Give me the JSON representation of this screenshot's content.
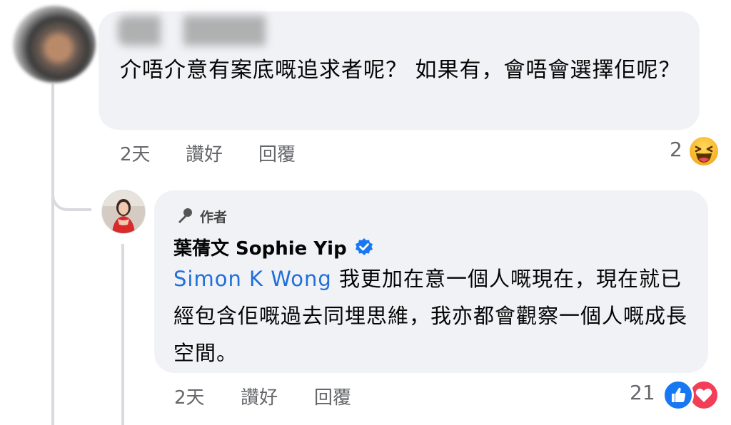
{
  "comment_1": {
    "text": "介唔介意有案底嘅追求者呢？ 如果有，會唔會選擇佢呢？",
    "time": "2天",
    "like_label": "讚好",
    "reply_label": "回覆",
    "reaction_count": "2",
    "reaction_icon": "haha-emoji-icon"
  },
  "comment_2": {
    "author_badge": "作者",
    "author_name": "葉蒨文 Sophie Yip",
    "mention": "Simon K Wong",
    "text": "我更加在意一個人嘅現在，現在就已經包含佢嘅過去同埋思維，我亦都會觀察一個人嘅成長空間。",
    "time": "2天",
    "like_label": "讚好",
    "reply_label": "回覆",
    "reaction_count": "21",
    "reaction_icons": [
      "like-icon",
      "love-icon"
    ]
  },
  "colors": {
    "bubble": "#f0f2f5",
    "mention": "#216fdb",
    "secondary_text": "#65676b",
    "like": "#1877f2",
    "love": "#f33e58",
    "verified": "#1877f2"
  }
}
